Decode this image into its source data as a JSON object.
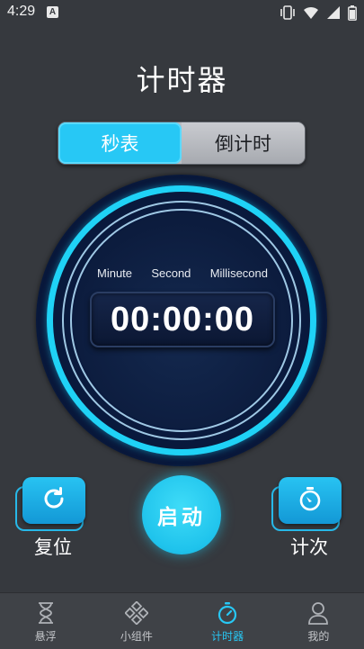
{
  "status_bar": {
    "time": "4:29",
    "notification_badge": "A",
    "icons": [
      "vibrate-icon",
      "wifi-icon",
      "signal-icon",
      "battery-icon"
    ]
  },
  "page": {
    "title": "计时器"
  },
  "tabs": [
    {
      "label": "秒表",
      "active": true
    },
    {
      "label": "倒计时",
      "active": false
    }
  ],
  "stopwatch": {
    "labels": {
      "minute": "Minute",
      "second": "Second",
      "millisecond": "Millisecond"
    },
    "time": "00:00:00"
  },
  "controls": {
    "reset_label": "复位",
    "start_label": "启动",
    "lap_label": "计次"
  },
  "bottom_nav": [
    {
      "label": "悬浮",
      "icon": "hourglass-icon",
      "active": false
    },
    {
      "label": "小组件",
      "icon": "widget-icon",
      "active": false
    },
    {
      "label": "计时器",
      "icon": "stopwatch-icon",
      "active": true
    },
    {
      "label": "我的",
      "icon": "person-icon",
      "active": false
    }
  ],
  "colors": {
    "accent": "#27c8f5",
    "background": "#36393e",
    "dial": "#0b1a3b",
    "nav_background": "#3f4247"
  }
}
